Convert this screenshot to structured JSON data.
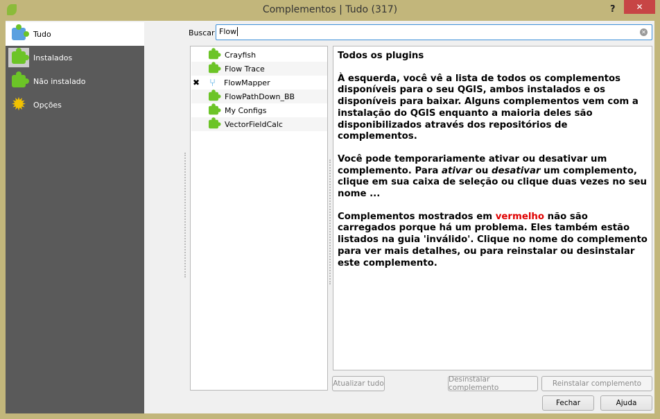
{
  "window": {
    "title": "Complementos | Tudo (317)",
    "help": "?",
    "close": "✕"
  },
  "sidebar": {
    "items": [
      {
        "label": "Tudo",
        "icon": "all-plugins-icon"
      },
      {
        "label": "Instalados",
        "icon": "installed-icon"
      },
      {
        "label": "Não instalado",
        "icon": "not-installed-icon"
      },
      {
        "label": "Opções",
        "icon": "gear-icon"
      }
    ]
  },
  "search": {
    "label": "Buscar",
    "value": "Flow"
  },
  "plugins": [
    {
      "name": "Crayfish",
      "checked": false,
      "icon": "puzzle-icon"
    },
    {
      "name": "Flow Trace",
      "checked": false,
      "icon": "puzzle-icon"
    },
    {
      "name": "FlowMapper",
      "checked": true,
      "icon": "flowmapper-icon"
    },
    {
      "name": "FlowPathDown_BB",
      "checked": false,
      "icon": "puzzle-icon"
    },
    {
      "name": "My Configs",
      "checked": false,
      "icon": "puzzle-icon"
    },
    {
      "name": "VectorFieldCalc",
      "checked": false,
      "icon": "puzzle-icon"
    }
  ],
  "info": {
    "heading": "Todos os plugins",
    "p1": "À esquerda, você vê a lista de todos os complementos disponíveis para o seu QGIS, ambos instalados e os disponíveis para baixar. Alguns complementos vem com a instalação do QGIS enquanto a maioria deles são disponibilizados através dos repositórios de complementos.",
    "p2a": "Você pode temporariamente ativar ou desativar um complemento. Para ",
    "p2b": "ativar",
    "p2c": " ou ",
    "p2d": "desativar",
    "p2e": " um complemento, clique em sua caixa de seleção ou clique duas vezes no seu nome ...",
    "p3a": "Complementos mostrados em ",
    "p3b": "vermelho",
    "p3c": " não são carregados porque há um problema. Eles também estão listados na guia 'inválido'. Clique no nome do complemento para ver mais detalhes, ou para reinstalar ou desinstalar este complemento.",
    "red": "#e00000"
  },
  "buttons": {
    "update_all": "Atualizar tudo",
    "uninstall": "Desinstalar complemento",
    "reinstall": "Reinstalar complemento",
    "close": "Fechar",
    "help": "Ajuda"
  }
}
